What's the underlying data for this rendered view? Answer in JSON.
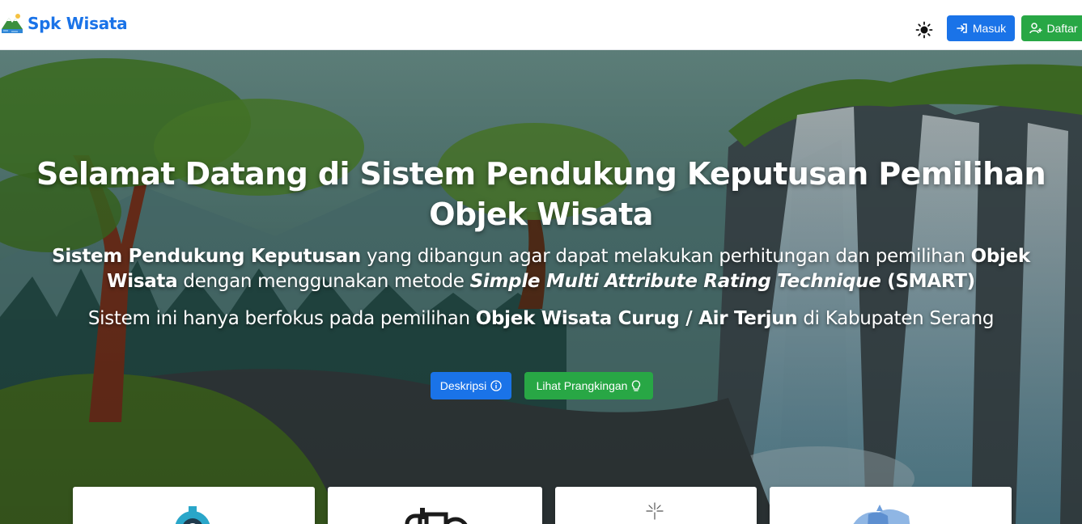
{
  "brand": {
    "name": "Spk Wisata",
    "logo_icon": "mountain-lake-logo-icon"
  },
  "navbar": {
    "theme_icon": "sun-icon",
    "login_label": "Masuk",
    "login_icon": "login-arrow-icon",
    "register_label": "Daftar",
    "register_icon": "user-plus-icon"
  },
  "hero": {
    "title": "Selamat Datang di Sistem Pendukung Keputusan Pemilihan Objek Wisata",
    "desc_part1": "Sistem Pendukung Keputusan",
    "desc_part2": " yang dibangun agar dapat melakukan perhitungan dan pemilihan ",
    "desc_part3": "Objek Wisata",
    "desc_part4": " dengan menggunakan metode ",
    "desc_part5": "Simple Multi Attribute Rating Technique",
    "desc_part6": " (SMART)",
    "focus_part1": "Sistem ini hanya berfokus pada pemilihan ",
    "focus_part2": "Objek Wisata Curug / Air Terjun",
    "focus_part3": " di Kabupaten Serang",
    "btn_desc_label": "Deskripsi",
    "btn_desc_icon": "info-circle-icon",
    "btn_rank_label": "Lihat Prangkingan",
    "btn_rank_icon": "lightbulb-icon"
  },
  "cards": [
    {
      "icon": "gear-icon"
    },
    {
      "icon": "binoculars-icon"
    },
    {
      "icon": "sparkle-icon"
    },
    {
      "icon": "waterfall-icon"
    }
  ],
  "colors": {
    "primary": "#1a73e8",
    "success": "#28a745",
    "brand": "#1a73e8"
  }
}
